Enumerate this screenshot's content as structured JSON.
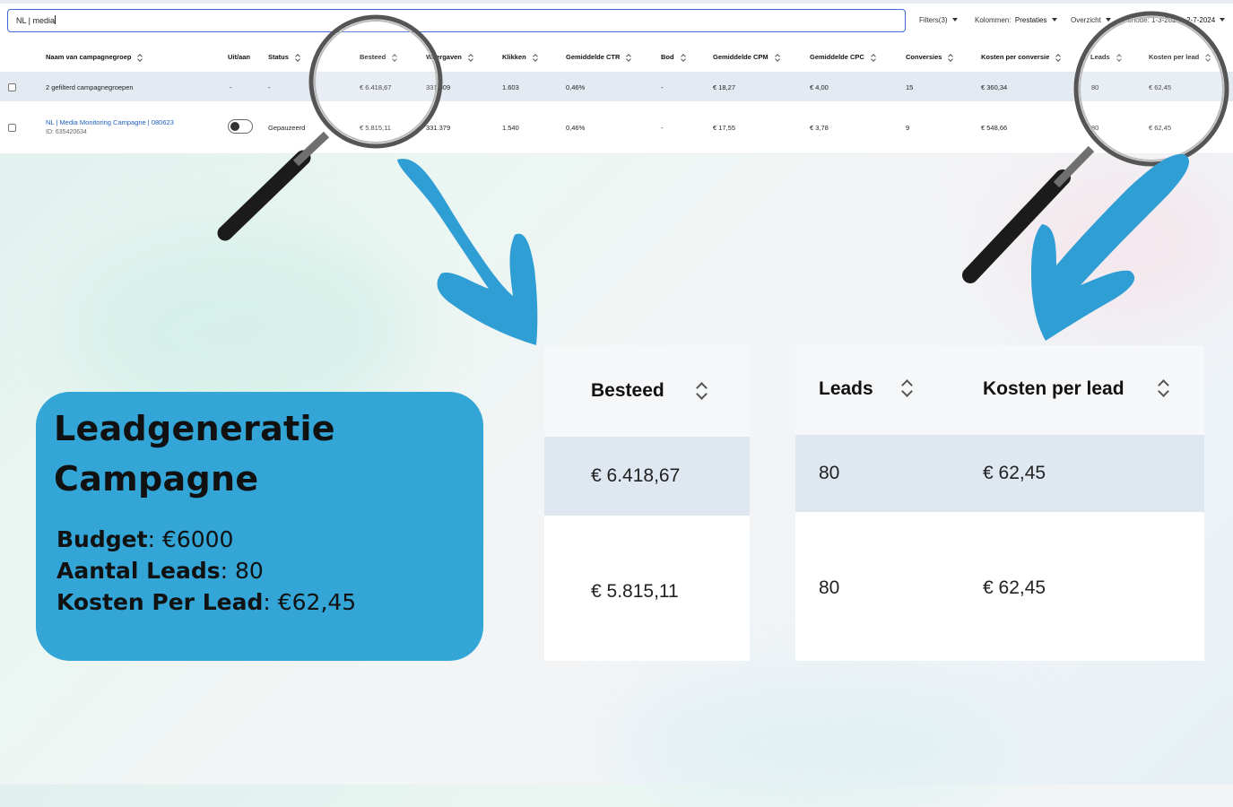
{
  "search": {
    "value": "NL | media"
  },
  "toolbar": {
    "filters": "Filters(3)",
    "columns_label": "Kolommen:",
    "columns_value": "Prestaties",
    "overview": "Overzicht",
    "period_label": "Periode:",
    "period_value": "1-3-2023 - 2-7-2024"
  },
  "table": {
    "headers": [
      "Naam van campagnegroep",
      "Uit/aan",
      "Status",
      "Besteed",
      "Weergaven",
      "Klikken",
      "Gemiddelde CTR",
      "Bod",
      "Gemiddelde CPM",
      "Gemiddelde CPC",
      "Conversies",
      "Kosten per conversie",
      "Leads",
      "Kosten per lead"
    ],
    "summary_row": {
      "name": "2 gefilterd campagnegroepen",
      "toggle": "-",
      "status": "-",
      "spent": "€ 6.418,67",
      "impressions": "331.809",
      "clicks": "1.603",
      "ctr": "0,46%",
      "bid": "-",
      "cpm": "€ 18,27",
      "cpc": "€ 4,00",
      "conversions": "15",
      "cost_per_conversion": "€ 360,34",
      "leads": "80",
      "cost_per_lead": "€ 62,45"
    },
    "campaign_row": {
      "name": "NL | Media Monitoring Campagne | 080623",
      "id": "ID: 635420634",
      "status": "Gepauzeerd",
      "spent": "€ 5.815,11",
      "impressions": "331.379",
      "clicks": "1.540",
      "ctr": "0,46%",
      "bid": "-",
      "cpm": "€ 17,55",
      "cpc": "€ 3,78",
      "conversions": "9",
      "cost_per_conversion": "€ 548,66",
      "leads": "80",
      "cost_per_lead": "€ 62,45"
    }
  },
  "card": {
    "title_line1": "Leadgeneratie",
    "title_line2": "Campagne",
    "budget_label": "Budget",
    "budget_value": ": €6000",
    "leads_label": "Aantal Leads",
    "leads_value": ": 80",
    "cpl_label": "Kosten Per Lead",
    "cpl_value": ": €62,45"
  },
  "zoom_spent": {
    "header": "Besteed",
    "row1": "€ 6.418,67",
    "row2": "€ 5.815,11"
  },
  "zoom_leads": {
    "header_leads": "Leads",
    "header_cpl": "Kosten per lead",
    "row1_leads": "80",
    "row1_cpl": "€ 62,45",
    "row2_leads": "80",
    "row2_cpl": "€ 62,45"
  },
  "colors": {
    "card": "#33a5d6",
    "arrow": "#2f9ed4",
    "link": "#1f5fbf",
    "search_border": "#3d6bd0"
  }
}
